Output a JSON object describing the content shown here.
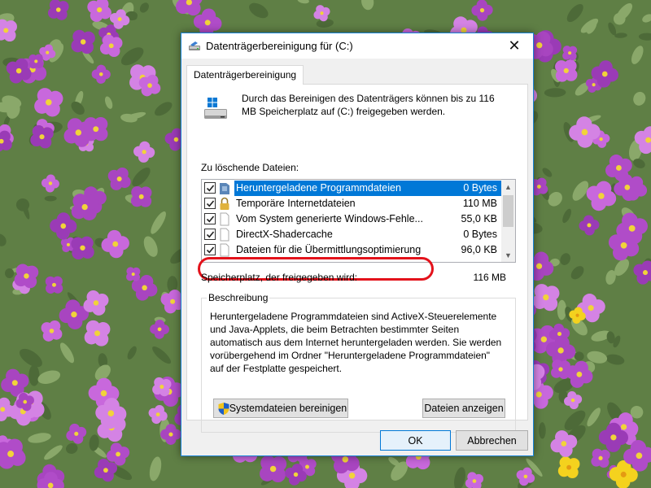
{
  "window": {
    "title": "Datenträgerbereinigung für  (C:)",
    "close_glyph": "✕"
  },
  "tabs": [
    {
      "label": "Datenträgerbereinigung",
      "active": true
    }
  ],
  "intro_text": "Durch das Bereinigen des Datenträgers können bis zu 116 MB Speicherplatz auf  (C:) freigegeben werden.",
  "files_label": "Zu löschende Dateien:",
  "files": [
    {
      "name": "Heruntergeladene Programmdateien",
      "size": "0 Bytes",
      "checked": true,
      "selected": true,
      "icon": "folder-icon"
    },
    {
      "name": "Temporäre Internetdateien",
      "size": "110 MB",
      "checked": true,
      "selected": false,
      "icon": "lock-icon"
    },
    {
      "name": "Vom System generierte Windows-Fehle...",
      "size": "55,0 KB",
      "checked": true,
      "selected": false,
      "icon": "document-icon"
    },
    {
      "name": "DirectX-Shadercache",
      "size": "0 Bytes",
      "checked": true,
      "selected": false,
      "icon": "document-icon"
    },
    {
      "name": "Dateien für die Übermittlungsoptimierung",
      "size": "96,0 KB",
      "checked": true,
      "selected": false,
      "icon": "document-icon"
    }
  ],
  "space_label": "Speicherplatz, der freigegeben wird:",
  "space_value": "116 MB",
  "description": {
    "legend": "Beschreibung",
    "text": "Heruntergeladene Programmdateien sind ActiveX-Steuerelemente und Java-Applets, die beim Betrachten bestimmter Seiten automatisch aus dem Internet heruntergeladen werden. Sie werden vorübergehend im Ordner \"Heruntergeladene Programmdateien\" auf der Festplatte gespeichert."
  },
  "buttons": {
    "system_files": "Systemdateien bereinigen",
    "show_files": "Dateien anzeigen",
    "ok": "OK",
    "cancel": "Abbrechen"
  },
  "colors": {
    "selection": "#0078d7",
    "window_border": "#1883d7",
    "annotation": "#e3121b"
  }
}
